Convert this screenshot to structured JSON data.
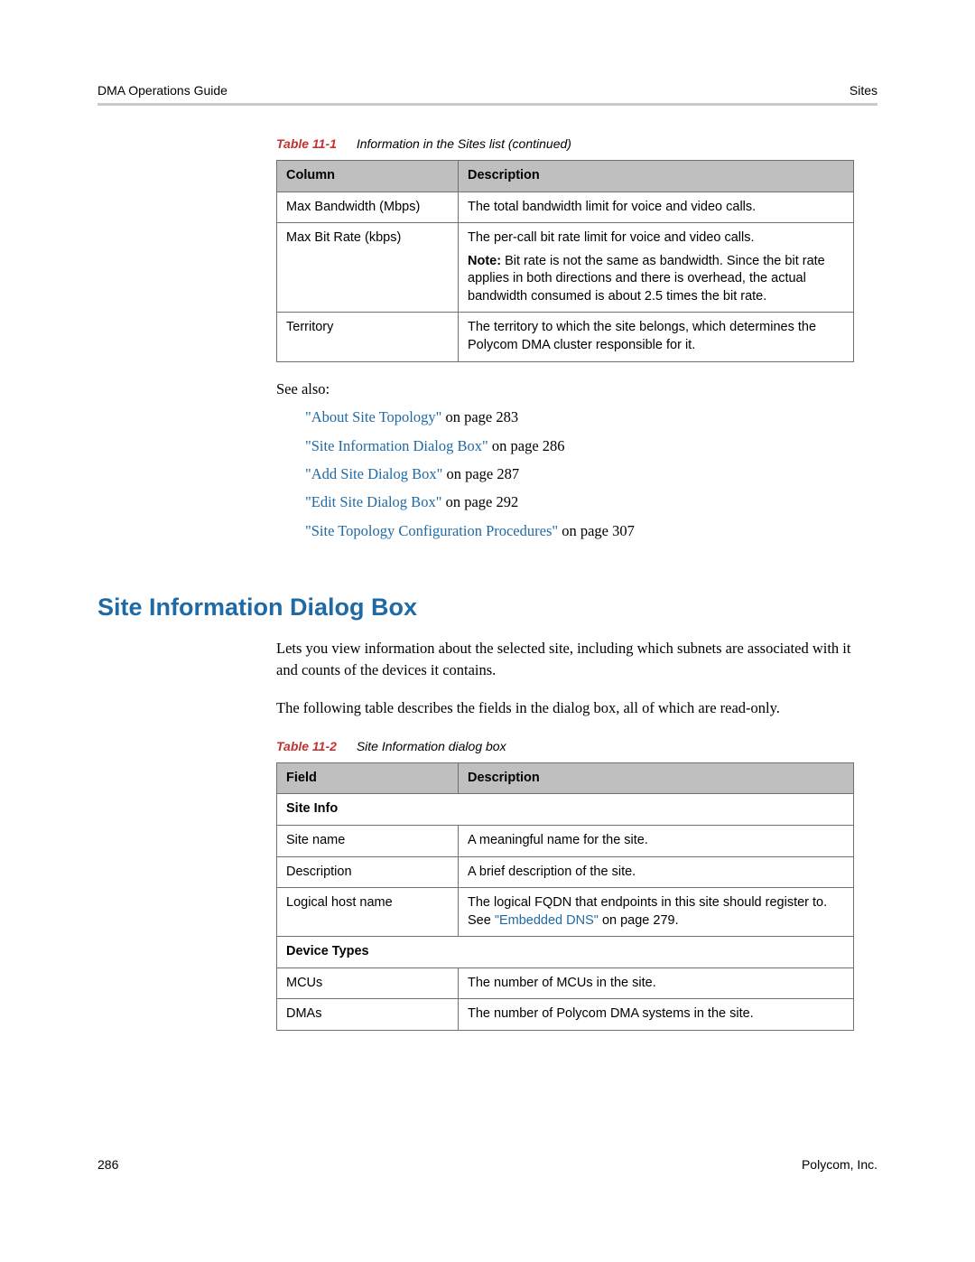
{
  "header": {
    "left": "DMA Operations Guide",
    "right": "Sites"
  },
  "table1": {
    "caption_num": "Table 11-1",
    "caption_text": "Information in the Sites list  (continued)",
    "head": {
      "c0": "Column",
      "c1": "Description"
    },
    "rows": [
      {
        "c0": "Max Bandwidth (Mbps)",
        "c1": "The total bandwidth limit for voice and video calls."
      },
      {
        "c0": "Max Bit Rate (kbps)",
        "c1_line1": "The per-call bit rate limit for voice and video calls.",
        "c1_note_label": "Note:",
        "c1_note_rest": " Bit rate is not the same as bandwidth. Since the bit rate applies in both directions and there is overhead, the actual bandwidth consumed is about 2.5 times the bit rate."
      },
      {
        "c0": "Territory",
        "c1": "The territory to which the site belongs, which determines the Polycom DMA cluster responsible for it."
      }
    ]
  },
  "see_also": {
    "intro": "See also:",
    "items": [
      {
        "link": "\"About Site Topology\"",
        "suffix": " on page 283"
      },
      {
        "link": "\"Site Information Dialog Box\"",
        "suffix": " on page 286"
      },
      {
        "link": "\"Add Site Dialog Box\"",
        "suffix": " on page 287"
      },
      {
        "link": "\"Edit Site Dialog Box\"",
        "suffix": " on page 292"
      },
      {
        "link": "\"Site Topology Configuration Procedures\"",
        "suffix": " on page 307"
      }
    ]
  },
  "section": {
    "heading": "Site Information Dialog Box",
    "p1": "Lets you view information about the selected site, including which subnets are associated with it and counts of the devices it contains.",
    "p2": "The following table describes the fields in the dialog box, all of which are read-only."
  },
  "table2": {
    "caption_num": "Table 11-2",
    "caption_text": "Site Information dialog box",
    "head": {
      "c0": "Field",
      "c1": "Description"
    },
    "section1": "Site Info",
    "rows1": [
      {
        "c0": "Site name",
        "c1": "A meaningful name for the site."
      },
      {
        "c0": "Description",
        "c1": "A brief description of the site."
      },
      {
        "c0": "Logical host name",
        "c1_pre": "The logical FQDN that endpoints in this site should register to. See ",
        "c1_link": "\"Embedded DNS\"",
        "c1_post": " on page 279."
      }
    ],
    "section2": "Device Types",
    "rows2": [
      {
        "c0": "MCUs",
        "c1": "The number of MCUs in the site."
      },
      {
        "c0": "DMAs",
        "c1": "The number of Polycom DMA systems in the site."
      }
    ]
  },
  "footer": {
    "page": "286",
    "company": "Polycom, Inc."
  }
}
